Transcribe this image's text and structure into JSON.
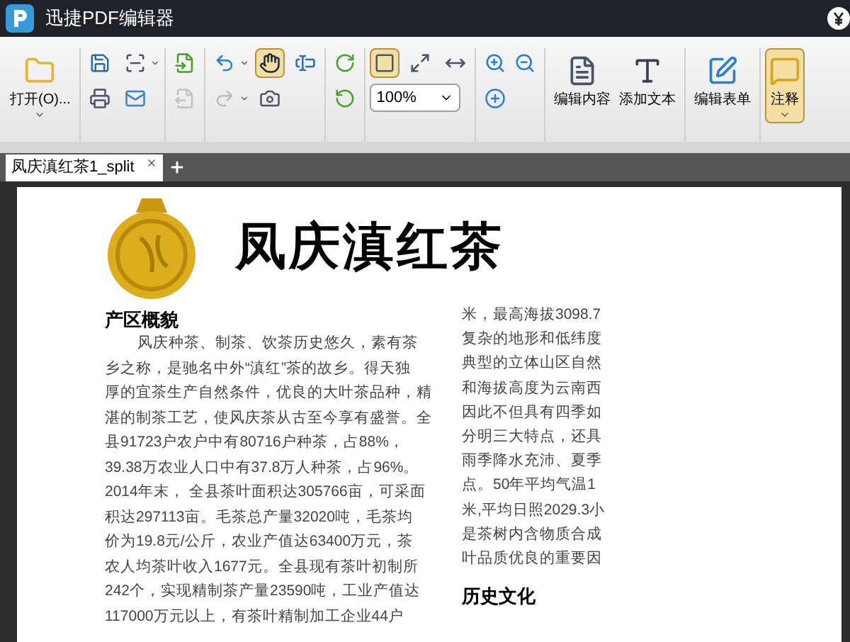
{
  "window": {
    "title": "迅捷PDF编辑器"
  },
  "toolbar": {
    "tools": [
      {
        "kind": "large",
        "label": "打开(O)...",
        "menu": true,
        "selected": false,
        "disabled": false
      },
      {
        "kind": "small",
        "menu": false,
        "selected": false,
        "disabled": false
      },
      {
        "kind": "small",
        "menu": true,
        "selected": false,
        "disabled": false
      },
      {
        "kind": "small",
        "menu": false,
        "selected": false,
        "disabled": false
      },
      {
        "kind": "small",
        "menu": false,
        "selected": false,
        "disabled": false
      },
      {
        "kind": "small",
        "menu": false,
        "selected": false,
        "disabled": false
      },
      {
        "kind": "small",
        "menu": false,
        "selected": false,
        "disabled": true
      },
      {
        "kind": "small",
        "menu": true,
        "selected": false,
        "disabled": false
      },
      {
        "kind": "small",
        "menu": true,
        "selected": false,
        "disabled": true
      },
      {
        "kind": "small",
        "menu": false,
        "selected": true,
        "disabled": false
      },
      {
        "kind": "small",
        "menu": false,
        "selected": false,
        "disabled": false
      },
      {
        "kind": "small",
        "menu": false,
        "selected": false,
        "disabled": false
      },
      {
        "kind": "small",
        "menu": false,
        "selected": false,
        "disabled": false
      },
      {
        "kind": "small",
        "menu": false,
        "selected": false,
        "disabled": false
      },
      {
        "kind": "small",
        "menu": false,
        "selected": true,
        "disabled": false
      },
      {
        "kind": "small",
        "menu": false,
        "selected": false,
        "disabled": false
      },
      {
        "kind": "small",
        "menu": false,
        "selected": false,
        "disabled": false
      },
      {
        "kind": "zoom",
        "value": "100%",
        "menu": true
      },
      {
        "kind": "small",
        "menu": false,
        "selected": false,
        "disabled": false
      },
      {
        "kind": "small",
        "menu": false,
        "selected": false,
        "disabled": false
      },
      {
        "kind": "small",
        "menu": false,
        "selected": false,
        "disabled": false
      },
      {
        "kind": "large",
        "label": "编辑内容",
        "menu": false,
        "selected": false,
        "disabled": false
      },
      {
        "kind": "large",
        "label": "添加文本",
        "menu": false,
        "selected": false,
        "disabled": false
      },
      {
        "kind": "large",
        "label": "编辑表单",
        "menu": false,
        "selected": false,
        "disabled": false
      },
      {
        "kind": "large",
        "label": "注释",
        "menu": true,
        "selected": true,
        "disabled": false
      }
    ]
  },
  "tabs": [
    {
      "label": "凤庆滇红茶1_split",
      "selected": true
    }
  ],
  "document": {
    "title": "凤庆滇红茶",
    "left_column": {
      "heading": "产区概貌",
      "lines": [
        "风庆种茶、制茶、饮茶历史悠久，素有茶",
        "乡之称，是驰名中外“滇红”茶的故乡。得天独",
        "厚的宜茶生产自然条件，优良的大叶茶品种，精",
        "湛的制茶工艺，使风庆茶从古至今享有盛誉。全",
        "县91723户农户中有80716户种茶，占88%，",
        "39.38万农业人口中有37.8万人种茶，占96%。",
        "2014年末， 全县茶叶面积达305766亩，可采面",
        "积达297113亩。毛茶总产量32020吨，毛茶均",
        "价为19.8元/公斤，农业产值达63400万元，茶",
        "农人均茶叶收入1677元。全县现有茶叶初制所",
        "242个，实现精制茶产量23590吨，工业产值达",
        "117000万元以上，有茶叶精制加工企业44户"
      ]
    },
    "right_column": {
      "lines": [
        "米，最高海拔3098.7",
        "复杂的地形和低纬度",
        "典型的立体山区自然",
        "和海拔高度为云南西",
        "因此不但具有四季如",
        "分明三大特点，还具",
        "雨季降水充沛、夏季",
        "点。50年平均气温1",
        "米,平均日照2029.3小",
        "是茶树内含物质合成",
        "叶品质优良的重要因"
      ],
      "heading": "历史文化"
    }
  }
}
